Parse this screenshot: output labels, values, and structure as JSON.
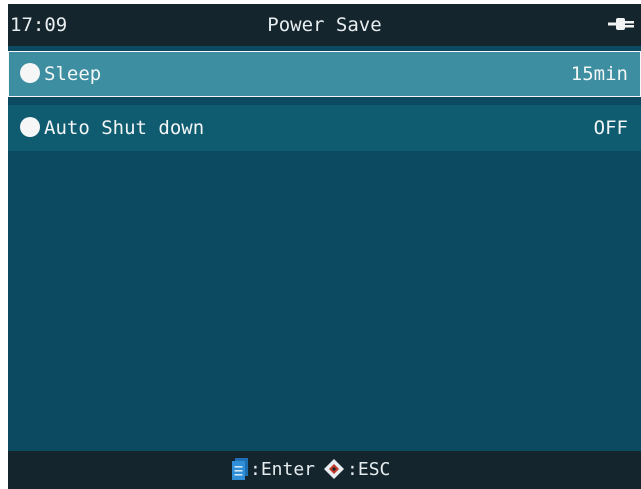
{
  "status_bar": {
    "time": "17:09",
    "title": "Power Save",
    "power_icon": "plug-icon"
  },
  "menu": {
    "items": [
      {
        "label": "Sleep",
        "value": "15min",
        "selected": true
      },
      {
        "label": "Auto Shut down",
        "value": "OFF",
        "selected": false
      }
    ]
  },
  "footer": {
    "enter_icon": "document-icon",
    "enter_label": ":Enter",
    "esc_icon": "diamond-icon",
    "esc_label": ":ESC"
  },
  "colors": {
    "background": "#0b4a60",
    "bar": "#15252d",
    "selected_row": "#3d8ea0",
    "row": "#0f5b70",
    "enter_icon": "#2e8fd8",
    "esc_icon_accent": "#c0392b"
  }
}
